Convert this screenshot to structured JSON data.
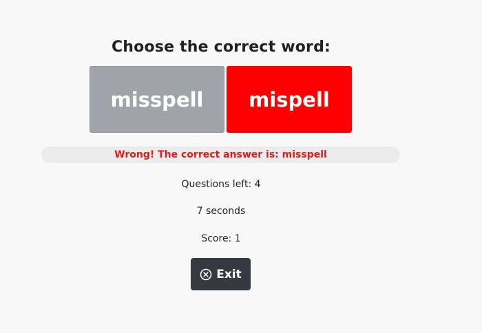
{
  "quiz": {
    "title": "Choose the correct word:",
    "choices": [
      {
        "label": "misspell",
        "state": "neutral",
        "color": "#9ea4a9"
      },
      {
        "label": "mispell",
        "state": "selected-wrong",
        "color": "#ff0000"
      }
    ],
    "feedback": "Wrong! The correct answer is: misspell",
    "feedback_color": "#e01a1a"
  },
  "status": {
    "questions_left": "Questions left: 4",
    "timer": "7 seconds",
    "score": "Score: 1"
  },
  "controls": {
    "exit_label": "Exit",
    "exit_icon": "close-circle-icon",
    "exit_color": "#343a40"
  }
}
